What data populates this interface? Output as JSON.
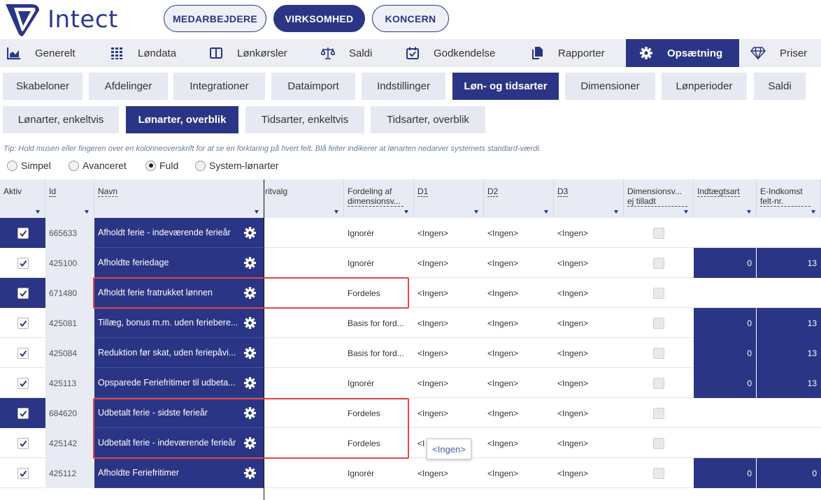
{
  "app": {
    "logo_text": "Intect",
    "brand_color": "#2b3585"
  },
  "top_nav": [
    {
      "label": "MEDARBEJDERE",
      "active": false
    },
    {
      "label": "VIRKSOMHED",
      "active": true
    },
    {
      "label": "KONCERN",
      "active": false
    }
  ],
  "main_tabs": [
    {
      "label": "Generelt",
      "icon": "chart-icon",
      "active": false
    },
    {
      "label": "Løndata",
      "icon": "grid-icon",
      "active": false
    },
    {
      "label": "Lønkørsler",
      "icon": "columns-icon",
      "active": false
    },
    {
      "label": "Saldi",
      "icon": "balance-scale-icon",
      "active": false
    },
    {
      "label": "Godkendelse",
      "icon": "calendar-check-icon",
      "active": false
    },
    {
      "label": "Rapporter",
      "icon": "copy-icon",
      "active": false
    },
    {
      "label": "Opsætning",
      "icon": "gear-icon",
      "active": true
    },
    {
      "label": "Priser",
      "icon": "diamond-icon",
      "active": false
    }
  ],
  "sub_tabs_row1": [
    {
      "label": "Skabeloner",
      "active": false
    },
    {
      "label": "Afdelinger",
      "active": false
    },
    {
      "label": "Integrationer",
      "active": false
    },
    {
      "label": "Dataimport",
      "active": false
    },
    {
      "label": "Indstillinger",
      "active": false
    },
    {
      "label": "Løn- og tidsarter",
      "active": true
    },
    {
      "label": "Dimensioner",
      "active": false
    },
    {
      "label": "Lønperioder",
      "active": false
    },
    {
      "label": "Saldi",
      "active": false
    }
  ],
  "sub_tabs_row2": [
    {
      "label": "Lønarter, enkeltvis",
      "active": false
    },
    {
      "label": "Lønarter, overblik",
      "active": true
    },
    {
      "label": "Tidsarter, enkeltvis",
      "active": false
    },
    {
      "label": "Tidsarter, overblik",
      "active": false
    }
  ],
  "tip": "Tip: Hold musen eller fingeren over en kolonneoverskrift for at se en forklaring på hvert felt. Blå felter indikerer at lønarten nedarver systemets standard-værdi.",
  "view_modes": [
    {
      "label": "Simpel",
      "selected": false
    },
    {
      "label": "Avanceret",
      "selected": false
    },
    {
      "label": "Fuld",
      "selected": true
    },
    {
      "label": "System-lønarter",
      "selected": false
    }
  ],
  "table": {
    "columns": {
      "aktiv": "Aktiv",
      "id": "Id",
      "navn": "Navn",
      "ritvalg": "ritvalg",
      "fordeling": "Fordeling af dimensionsv...",
      "d1": "D1",
      "d2": "D2",
      "d3": "D3",
      "dim_ej": "Dimensionsv... ej tilladt",
      "indtaegt": "Indtægtsart",
      "eindkomst": "E-Indkomst felt-nr."
    },
    "rows": [
      {
        "selected": true,
        "id": "665633",
        "navn": "Afholdt ferie - indeværende ferieår",
        "fordeling": "Ignorér",
        "d1": "<Ingen>",
        "d2": "<Ingen>",
        "d3": "<Ingen>",
        "indtaegt": "",
        "eindkomst": ""
      },
      {
        "selected": false,
        "id": "425100",
        "navn": "Afholdte feriedage",
        "fordeling": "Ignorér",
        "d1": "<Ingen>",
        "d2": "<Ingen>",
        "d3": "<Ingen>",
        "indtaegt": "0",
        "eindkomst": "13"
      },
      {
        "selected": true,
        "id": "671480",
        "navn": "Afholdt ferie fratrukket lønnen",
        "fordeling": "Fordeles",
        "d1": "<Ingen>",
        "d2": "<Ingen>",
        "d3": "<Ingen>",
        "indtaegt": "",
        "eindkomst": ""
      },
      {
        "selected": false,
        "id": "425081",
        "navn": "Tillæg, bonus m.m. uden feriebere...",
        "fordeling": "Basis for ford...",
        "d1": "<Ingen>",
        "d2": "<Ingen>",
        "d3": "<Ingen>",
        "indtaegt": "0",
        "eindkomst": "13"
      },
      {
        "selected": false,
        "id": "425084",
        "navn": "Reduktion før skat, uden feriepåvi...",
        "fordeling": "Basis for ford...",
        "d1": "<Ingen>",
        "d2": "<Ingen>",
        "d3": "<Ingen>",
        "indtaegt": "0",
        "eindkomst": "13"
      },
      {
        "selected": false,
        "id": "425113",
        "navn": "Opsparede Feriefritimer til udbeta...",
        "fordeling": "Ignorér",
        "d1": "<Ingen>",
        "d2": "<Ingen>",
        "d3": "<Ingen>",
        "indtaegt": "0",
        "eindkomst": "13"
      },
      {
        "selected": true,
        "id": "684620",
        "navn": "Udbetalt ferie - sidste ferieår",
        "fordeling": "Fordeles",
        "d1": "<Ingen>",
        "d2": "<Ingen>",
        "d3": "<Ingen>",
        "indtaegt": "",
        "eindkomst": ""
      },
      {
        "selected": false,
        "id": "425142",
        "navn": "Udbetalt ferie - indeværende ferieår",
        "fordeling": "Fordeles",
        "d1": "<I",
        "d2": "<Ingen>",
        "d3": "<Ingen>",
        "indtaegt": "",
        "eindkomst": ""
      },
      {
        "selected": false,
        "id": "425112",
        "navn": "Afholdte Feriefritimer",
        "fordeling": "Ignorér",
        "d1": "<Ingen>",
        "d2": "<Ingen>",
        "d3": "<Ingen>",
        "indtaegt": "0",
        "eindkomst": "0"
      }
    ]
  },
  "tooltip": "<Ingen>",
  "colors": {
    "highlight_box": "#e0454a",
    "active_bg": "#2b3585",
    "id_cell_bg": "#e8ebf3"
  }
}
